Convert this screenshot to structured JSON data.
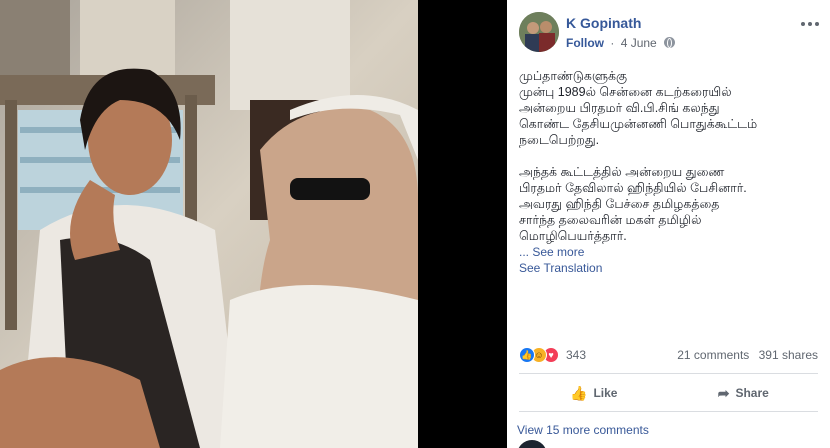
{
  "post": {
    "author": "K Gopinath",
    "follow_label": "Follow",
    "separator": "·",
    "date": "4 June",
    "paragraphs": [
      "முப்தாண்டுகளுக்கு\nமுன்பு 1989ல் சென்னை கடற்கரையில்\nஅன்றைய பிரதமர் வி.பி.சிங் கலந்து\nகொண்ட தேசியமுன்னணி பொதுக்கூட்டம்\nநடைபெற்றது.",
      "அந்தக் கூட்டத்தில் அன்றைய துணை\nபிரதமர் தேவிலால் ஹிந்தியில் பேசினார்.\nஅவரது ஹிந்தி பேச்சை தமிழகத்தை\nசார்ந்த தலைவரின் மகள் தமிழில்\nமொழிபெயர்த்தார்."
    ],
    "see_more": "... See more",
    "see_translation": "See Translation"
  },
  "stats": {
    "reaction_count": "343",
    "comments": "21 comments",
    "shares": "391 shares",
    "reaction_types": [
      "like-icon",
      "haha-icon",
      "love-icon"
    ]
  },
  "actions": {
    "like_label": "Like",
    "share_label": "Share"
  },
  "comments": {
    "view_more": "View 15 more comments"
  },
  "colors": {
    "link": "#385898",
    "author": "#365899",
    "like": "#1877f2",
    "love": "#f33e58",
    "haha": "#f7b125"
  }
}
